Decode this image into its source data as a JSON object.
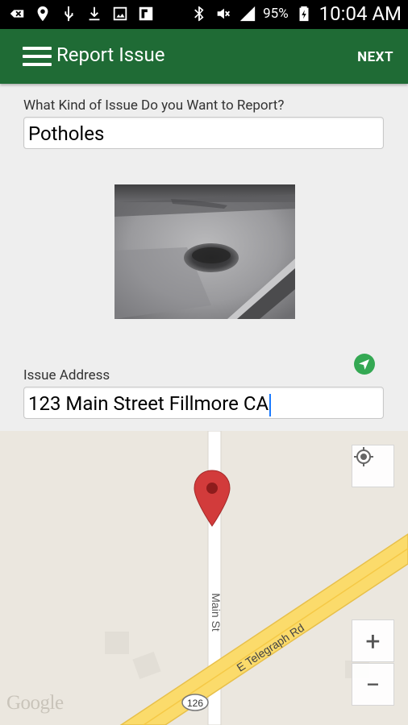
{
  "status_bar": {
    "battery": "95%",
    "time": "10:04 AM",
    "icons": [
      "notification-icon",
      "location-pin-icon",
      "usb-icon",
      "download-icon",
      "image-icon",
      "flipboard-icon",
      "bluetooth-icon",
      "mute-icon",
      "signal-icon",
      "battery-icon"
    ]
  },
  "app_bar": {
    "title": "Report Issue",
    "action": "NEXT",
    "color": "#1f6b35"
  },
  "form": {
    "issue_type_label": "What Kind of Issue Do you Want to Report?",
    "issue_type_value": "Potholes",
    "address_label": "Issue Address",
    "address_value": "123 Main Street Fillmore CA"
  },
  "map": {
    "street_main": "Main St",
    "street_telegraph": "E Telegraph Rd",
    "route_shield": "126",
    "attribution": "Google",
    "zoom_in": "+",
    "zoom_out": "−"
  }
}
